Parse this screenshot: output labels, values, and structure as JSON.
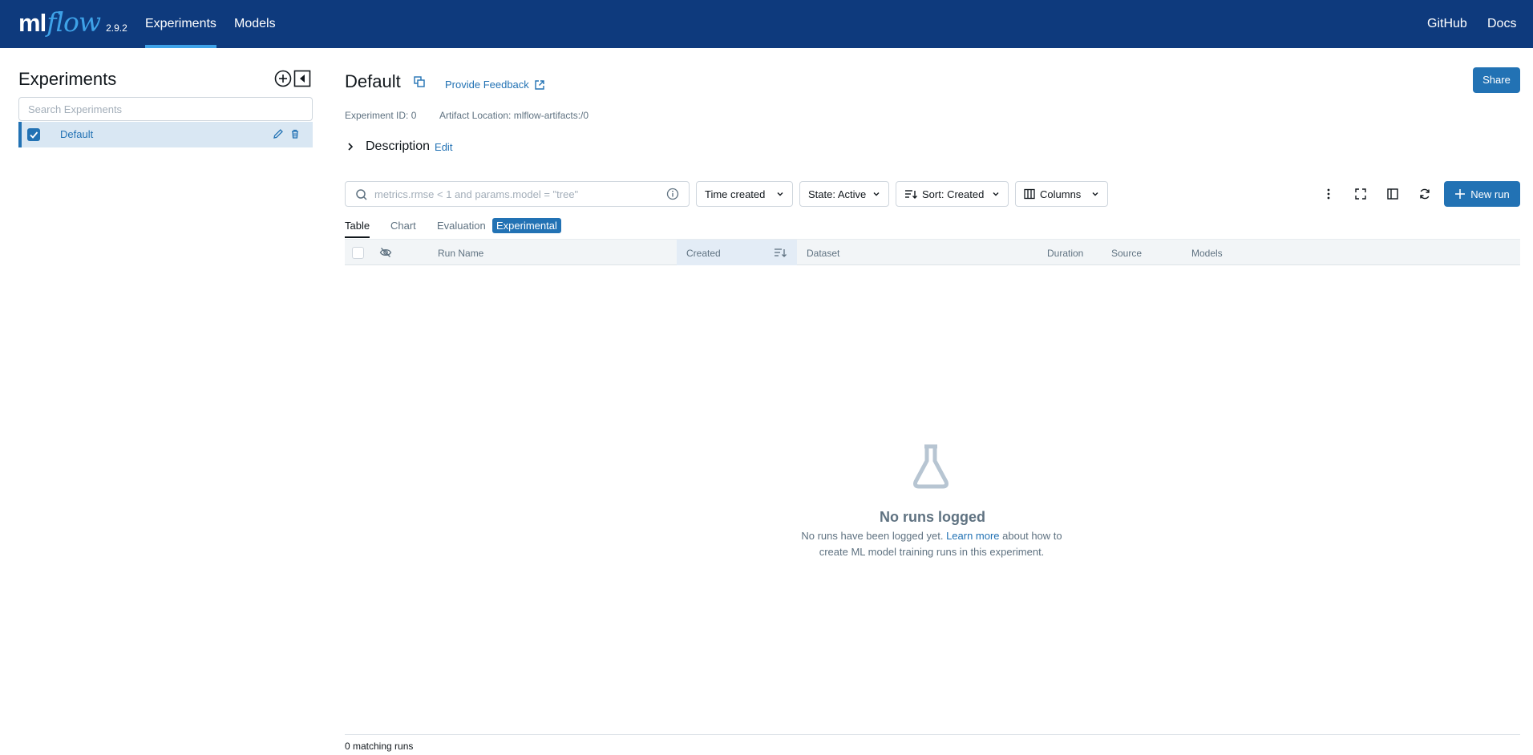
{
  "header": {
    "logo_ml": "ml",
    "logo_flow": "flow",
    "version": "2.9.2",
    "nav": {
      "experiments": "Experiments",
      "models": "Models"
    },
    "right": {
      "github": "GitHub",
      "docs": "Docs"
    }
  },
  "sidebar": {
    "title": "Experiments",
    "search_placeholder": "Search Experiments",
    "experiments": [
      {
        "name": "Default",
        "selected": true
      }
    ]
  },
  "main": {
    "title": "Default",
    "feedback": "Provide Feedback",
    "share": "Share",
    "experiment_id": "Experiment ID: 0",
    "artifact_location": "Artifact Location: mlflow-artifacts:/0",
    "description_label": "Description",
    "description_edit": "Edit"
  },
  "filters": {
    "search_placeholder": "metrics.rmse < 1 and params.model = \"tree\"",
    "time_created": "Time created",
    "state": "State: Active",
    "sort": "Sort: Created",
    "columns": "Columns",
    "new_run": "New run"
  },
  "tabs": {
    "table": "Table",
    "chart": "Chart",
    "evaluation": "Evaluation",
    "experimental": "Experimental"
  },
  "table": {
    "columns": [
      "Run Name",
      "Created",
      "Dataset",
      "Duration",
      "Source",
      "Models"
    ]
  },
  "empty": {
    "title": "No runs logged",
    "text_before": "No runs have been logged yet.",
    "link": "Learn more",
    "text_after": "about how to create ML model training runs in this experiment."
  },
  "footer": {
    "count": "0 matching runs"
  },
  "colors": {
    "header_bg": "#0e3a7d",
    "accent": "#2272b4",
    "logo_flow": "#3ea2e8"
  }
}
